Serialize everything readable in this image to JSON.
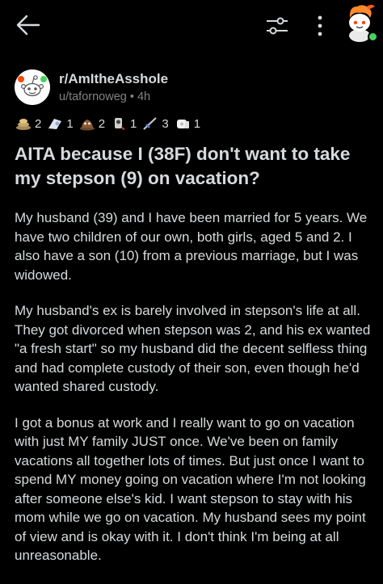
{
  "topbar": {
    "back_icon": "arrow-left-icon",
    "filter_icon": "sliders-icon",
    "more_icon": "vertical-dots-icon",
    "avatar": "user-snoo-avatar",
    "online_color": "#46d160"
  },
  "post": {
    "subreddit": "r/AmItheAsshole",
    "author": "u/tafornoweg",
    "time": "4h",
    "meta_sep": " • ",
    "awards": [
      {
        "icon": "award-icon-1",
        "count": "2"
      },
      {
        "icon": "award-icon-2",
        "count": "1"
      },
      {
        "icon": "award-icon-3",
        "count": "2"
      },
      {
        "icon": "award-icon-4",
        "count": "1"
      },
      {
        "icon": "award-icon-5",
        "count": "3"
      },
      {
        "icon": "award-icon-6",
        "count": "1"
      }
    ],
    "title": "AITA because I (38F) don't want to take my stepson (9) on vacation?",
    "paragraphs": [
      "My husband (39) and I have been married for 5 years. We have two children of our own, both girls, aged 5 and 2. I also have a son (10) from a previous marriage, but I was widowed.",
      "My husband's ex is barely involved in stepson's life at all. They got divorced when stepson was 2, and his ex wanted \"a fresh start\" so my husband did the decent selfless thing and had complete custody of their son, even though he'd wanted shared custody.",
      "I got a bonus at work and I really want to go on vacation with just MY family JUST once. We've been on family vacations all together lots of times. But just once I want to spend MY money going on vacation where I'm not looking after someone else's kid. I want stepson to stay with his mom while we go on vacation. My husband sees my point of view and is okay with it. I don't think I'm being at all unreasonable."
    ]
  },
  "colors": {
    "background": "#000000",
    "text": "#d7dadc",
    "muted": "#818384"
  }
}
